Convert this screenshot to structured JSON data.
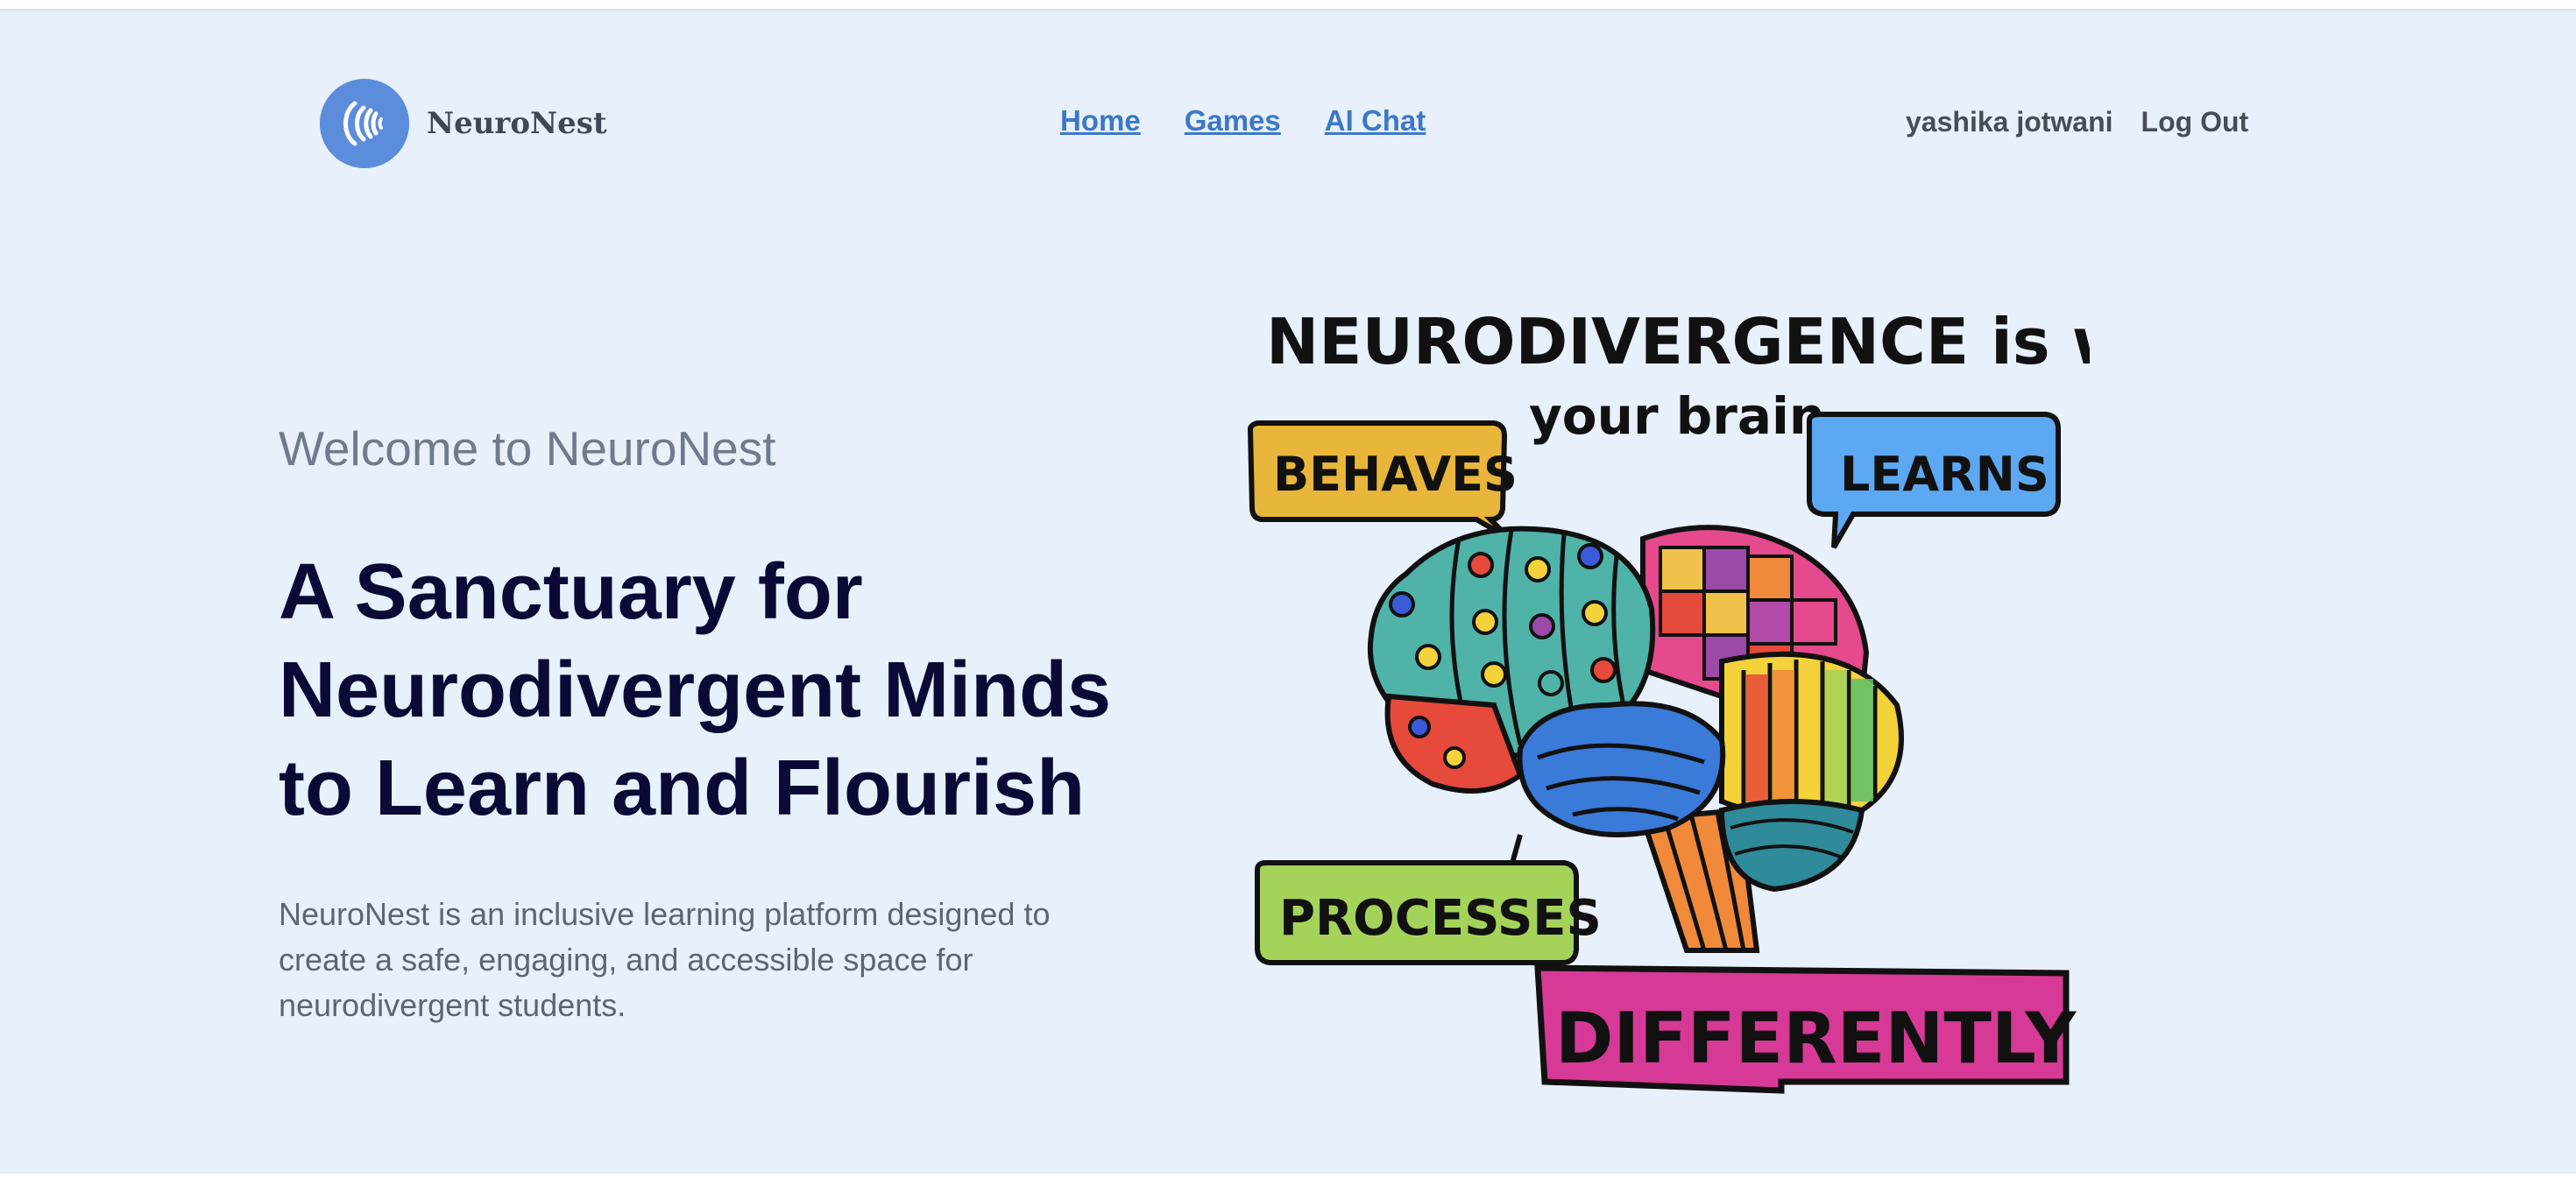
{
  "header": {
    "logo_text": "NeuroNest",
    "nav": [
      {
        "label": "Home"
      },
      {
        "label": "Games"
      },
      {
        "label": "AI Chat"
      }
    ],
    "user_name": "yashika jotwani",
    "logout_label": "Log Out"
  },
  "hero": {
    "welcome": "Welcome to NeuroNest",
    "headline_lines": [
      "A Sanctuary for",
      "Neurodivergent Minds",
      "to Learn and Flourish"
    ],
    "description_lines": [
      "NeuroNest is an inclusive learning platform designed to",
      "create a safe, engaging, and accessible space for",
      "neurodivergent students."
    ]
  },
  "illustration": {
    "title_line1": "NEURODIVERGENCE is when",
    "title_line2": "your brain",
    "bubble_behaves": "BEHAVES",
    "bubble_learns": "LEARNS",
    "bubble_processes": "PROCESSES",
    "banner_differently": "DIFFERENTLY"
  },
  "colors": {
    "background": "#e8f0fc",
    "brand_blue": "#5b8ddc",
    "link_blue": "#3b78c9",
    "headline_navy": "#0b0a36",
    "behaves_yellow": "#e8b63a",
    "learns_blue": "#5da8f2",
    "processes_green": "#a5d35a",
    "differently_magenta": "#d63a96"
  }
}
